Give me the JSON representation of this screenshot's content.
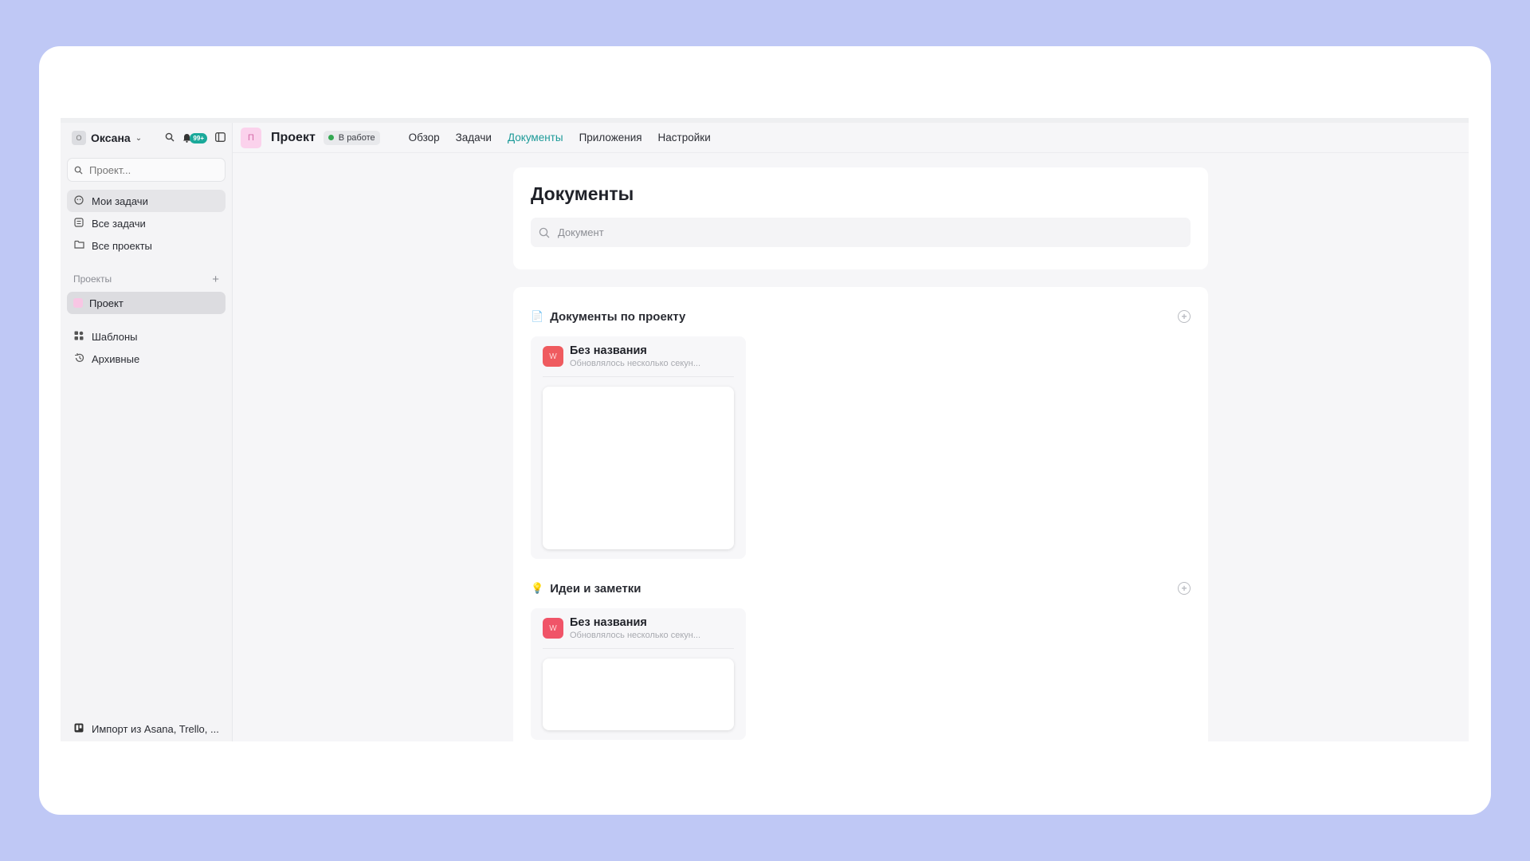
{
  "sidebar": {
    "user_initial": "О",
    "user_name": "Оксана",
    "badge": "99+",
    "search_placeholder": "Проект...",
    "nav": [
      {
        "label": "Мои задачи",
        "icon": "target-icon"
      },
      {
        "label": "Все задачи",
        "icon": "checklist-icon"
      },
      {
        "label": "Все проекты",
        "icon": "folder-icon"
      }
    ],
    "projects_section": "Проекты",
    "project_label": "Проект",
    "templates": "Шаблоны",
    "archived": "Архивные",
    "import": "Импорт из Asana, Trello, ..."
  },
  "topbar": {
    "project_initial": "П",
    "project_title": "Проект",
    "status": "В работе",
    "tabs": [
      "Обзор",
      "Задачи",
      "Документы",
      "Приложения",
      "Настройки"
    ],
    "active_tab": "Документы"
  },
  "documents": {
    "title": "Документы",
    "search_placeholder": "Документ",
    "sections": [
      {
        "emoji": "📄",
        "title": "Документы по проекту",
        "doc_icon": "W",
        "doc_name": "Без названия",
        "doc_sub": "Обновлялось несколько секун..."
      },
      {
        "emoji": "💡",
        "title": "Идеи и заметки",
        "doc_icon": "W",
        "doc_name": "Без названия",
        "doc_sub": "Обновлялось несколько секун..."
      }
    ]
  },
  "colors": {
    "background": "#bfc8f5",
    "accent": "#1c9a98",
    "badge": "#1aa99a",
    "doc_icon": "#ef5b5f",
    "status_dot": "#33a852"
  }
}
